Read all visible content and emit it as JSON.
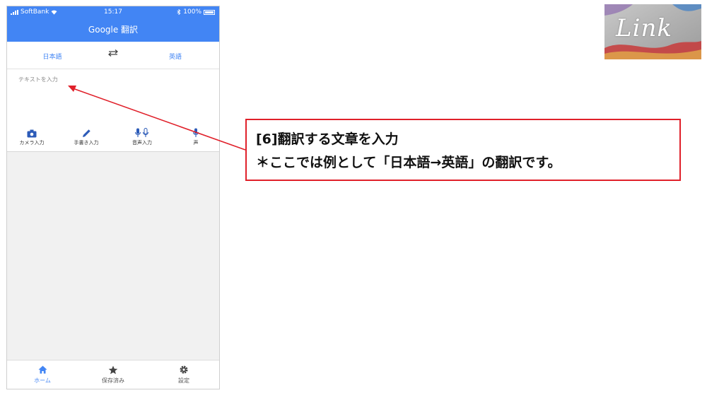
{
  "phone": {
    "status": {
      "carrier": "SoftBank",
      "time": "15:17",
      "battery": "100%"
    },
    "app_title": "Google 翻訳",
    "languages": {
      "source": "日本語",
      "target": "英語",
      "swap_icon": "swap-arrows-icon"
    },
    "input": {
      "placeholder": "テキストを入力"
    },
    "tools": [
      {
        "label": "カメラ入力",
        "icon": "camera-icon"
      },
      {
        "label": "手書き入力",
        "icon": "pen-icon"
      },
      {
        "label": "音声入力",
        "icon": "microphone-icon"
      },
      {
        "label": "声",
        "icon": "microphone-icon"
      }
    ],
    "nav": [
      {
        "label": "ホーム",
        "icon": "home-icon",
        "active": true
      },
      {
        "label": "保存済み",
        "icon": "star-icon",
        "active": false
      },
      {
        "label": "設定",
        "icon": "gear-icon",
        "active": false
      }
    ]
  },
  "callout": {
    "line1": "[6]翻訳する文章を入力",
    "line2": "＊ここでは例として「日本語→英語」の翻訳です。"
  },
  "logo": {
    "text": "Link"
  },
  "colors": {
    "accent": "#4285f4",
    "annotation": "#e0202a"
  }
}
